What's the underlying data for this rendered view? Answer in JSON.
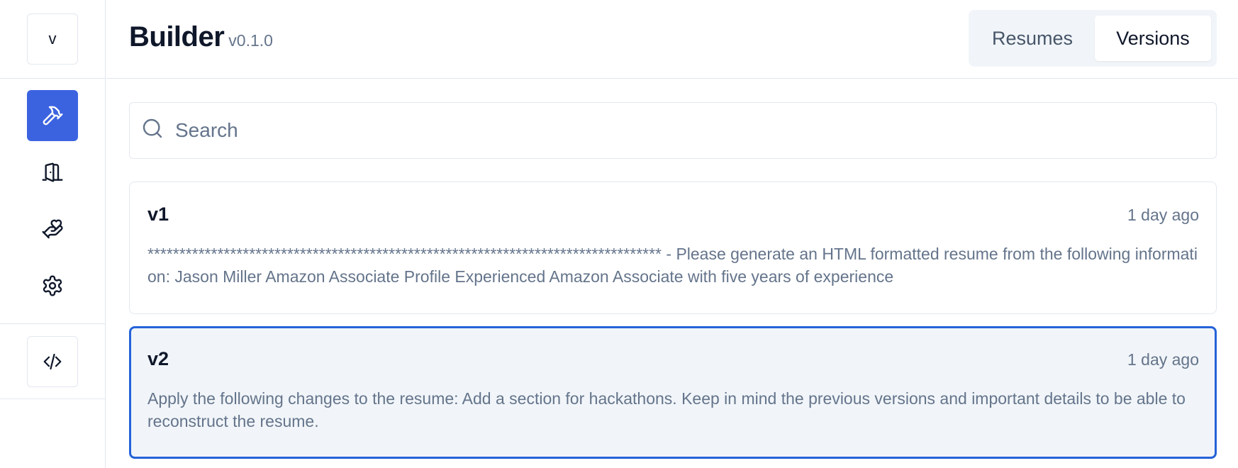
{
  "sidebar": {
    "avatar_letter": "v",
    "nav": [
      {
        "name": "builder",
        "icon": "hammer-icon",
        "active": true
      },
      {
        "name": "exit",
        "icon": "door-icon",
        "active": false
      },
      {
        "name": "hand-plant",
        "icon": "hand-heart-icon",
        "active": false
      },
      {
        "name": "settings",
        "icon": "gear-icon",
        "active": false
      }
    ],
    "bottom_icon": "code-icon"
  },
  "header": {
    "title": "Builder",
    "version": "v0.1.0",
    "tabs": [
      {
        "label": "Resumes",
        "selected": false
      },
      {
        "label": "Versions",
        "selected": true
      }
    ]
  },
  "search": {
    "placeholder": "Search",
    "value": ""
  },
  "versions": [
    {
      "title": "v1",
      "time": "1 day ago",
      "description": "********************************************************************************* - Please generate an HTML formatted resume from the following information: Jason Miller Amazon Associate Profile Experienced Amazon Associate with five years of experience",
      "selected": false
    },
    {
      "title": "v2",
      "time": "1 day ago",
      "description": "Apply the following changes to the resume: Add a section for hackathons. Keep in mind the previous versions and important details to be able to reconstruct the resume.",
      "selected": true
    }
  ],
  "colors": {
    "accent": "#3b63e0",
    "selected_border": "#2563d8",
    "muted_text": "#64748b",
    "border": "#e2e8f0"
  }
}
